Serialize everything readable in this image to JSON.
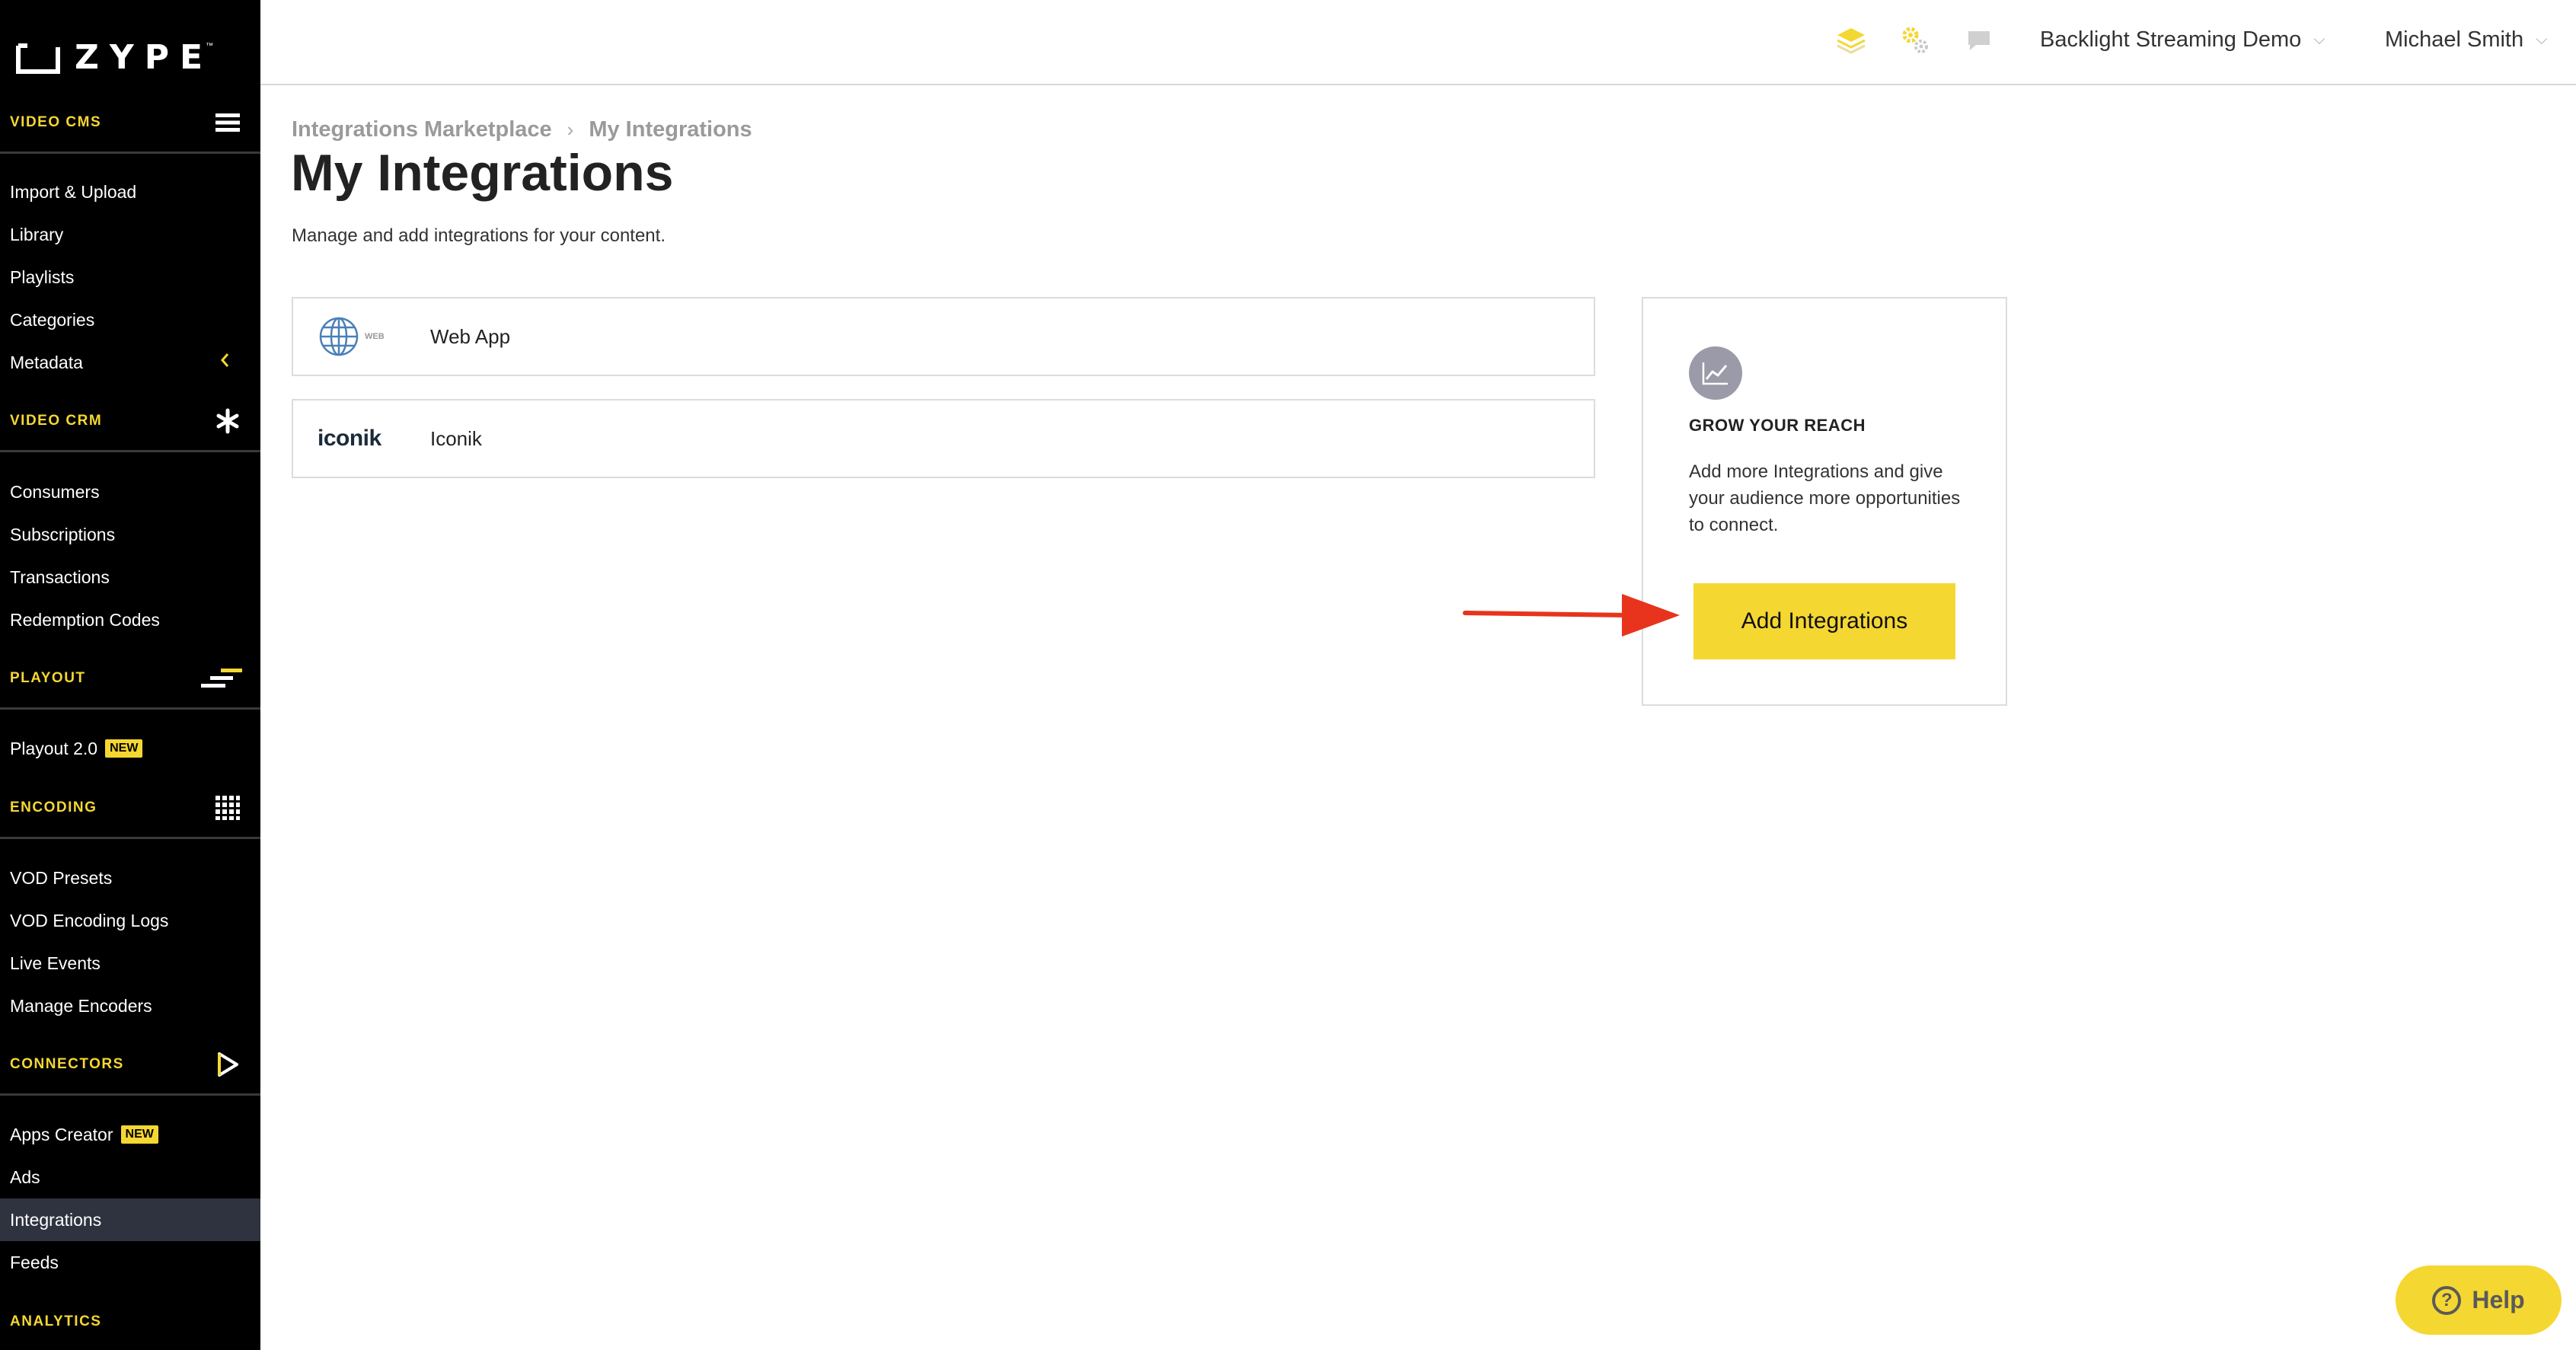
{
  "brand": {
    "logo_text": "ZYPE",
    "trademark": "™"
  },
  "sidebar": {
    "sections": [
      {
        "label": "VIDEO CMS",
        "icon": "hamburger-icon",
        "items": [
          {
            "label": "Import & Upload"
          },
          {
            "label": "Library"
          },
          {
            "label": "Playlists"
          },
          {
            "label": "Categories"
          },
          {
            "label": "Metadata"
          }
        ]
      },
      {
        "label": "VIDEO CRM",
        "icon": "asterisk-icon",
        "items": [
          {
            "label": "Consumers"
          },
          {
            "label": "Subscriptions"
          },
          {
            "label": "Transactions"
          },
          {
            "label": "Redemption Codes"
          }
        ]
      },
      {
        "label": "PLAYOUT",
        "icon": "playout-bars-icon",
        "items": [
          {
            "label": "Playout 2.0",
            "badge": "NEW"
          }
        ]
      },
      {
        "label": "ENCODING",
        "icon": "grid-icon",
        "items": [
          {
            "label": "VOD Presets"
          },
          {
            "label": "VOD Encoding Logs"
          },
          {
            "label": "Live Events"
          },
          {
            "label": "Manage Encoders"
          }
        ]
      },
      {
        "label": "CONNECTORS",
        "icon": "play-outline-icon",
        "items": [
          {
            "label": "Apps Creator",
            "badge": "NEW"
          },
          {
            "label": "Ads"
          },
          {
            "label": "Integrations",
            "active": true
          },
          {
            "label": "Feeds"
          }
        ]
      },
      {
        "label": "ANALYTICS",
        "icon": "",
        "items": []
      }
    ]
  },
  "topbar": {
    "icons": [
      "stack-layers-icon",
      "gears-icon",
      "chat-icon"
    ],
    "account": "Backlight Streaming Demo",
    "user": "Michael Smith"
  },
  "breadcrumb": {
    "parent": "Integrations Marketplace",
    "separator": "›",
    "current": "My Integrations"
  },
  "page": {
    "title": "My Integrations",
    "subtitle": "Manage and add integrations for your content."
  },
  "integrations": [
    {
      "name": "Web App",
      "logo": "globe-web-icon",
      "logo_caption": "WEB"
    },
    {
      "name": "Iconik",
      "logo": "iconik-logo",
      "logo_caption": "iconik"
    }
  ],
  "grow": {
    "heading": "GROW YOUR REACH",
    "text": "Add more Integrations and give your audience more opportunities to connect.",
    "button": "Add Integrations",
    "icon": "trend-chart-icon"
  },
  "help": {
    "label": "Help",
    "glyph": "?"
  },
  "colors": {
    "accent": "#f5d732",
    "sidebar_bg": "#000000",
    "active_item": "#2f3340",
    "annotation_arrow": "#e8341c"
  }
}
